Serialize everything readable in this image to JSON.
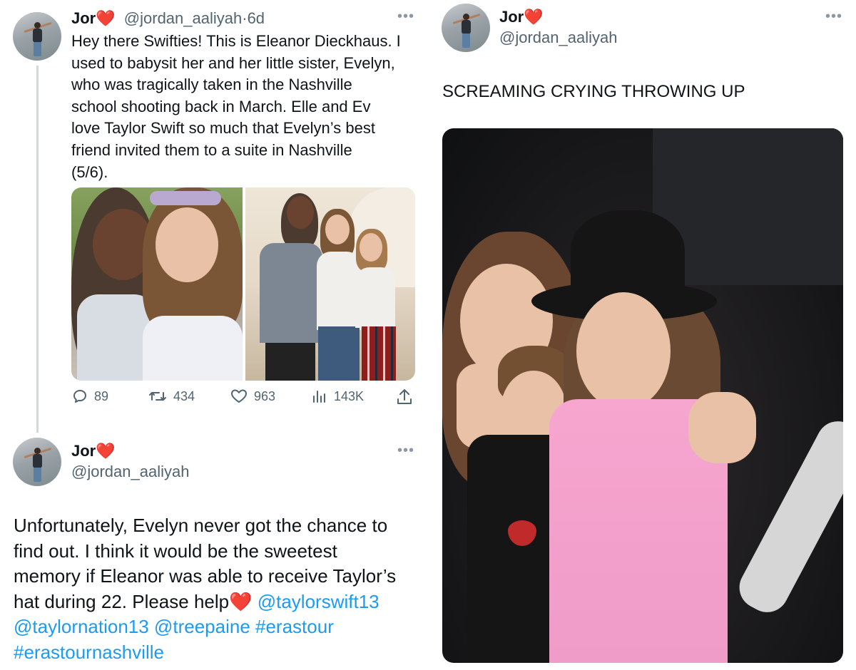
{
  "tweet1": {
    "name": "Jor",
    "heart": "❤️",
    "handle": "@jordan_aaliyah",
    "time": "6d",
    "separator": "·",
    "lines": [
      "Hey there Swifties! This is Eleanor Dieckhaus. I",
      "used to babysit her and her little sister, Evelyn,",
      "who was tragically taken in the Nashville",
      "school shooting back in March. Elle and Ev",
      "love Taylor Swift so much that Evelyn’s best",
      "friend invited them to a suite in Nashville",
      "(5/6)."
    ],
    "stats": {
      "replies": "89",
      "retweets": "434",
      "likes": "963",
      "views": "143K"
    }
  },
  "tweet2": {
    "name": "Jor",
    "heart": "❤️",
    "handle": "@jordan_aaliyah",
    "lines": [
      "Unfortunately, Evelyn never got the chance to",
      "find out. I think it would be the sweetest",
      "memory if Eleanor was able to receive Taylor’s"
    ],
    "line4_text": "hat during 22. Please help",
    "line4_heart": "❤️",
    "mention1": "@taylorswift13",
    "mention2": "@taylornation13",
    "mention3": "@treepaine",
    "hashtag1": "#erastour",
    "hashtag2": "#erastournashville"
  },
  "tweet3": {
    "name": "Jor",
    "heart": "❤️",
    "handle": "@jordan_aaliyah",
    "text": "SCREAMING CRYING THROWING UP"
  },
  "icons": {
    "more": "more-horizontal-icon",
    "reply": "reply-icon",
    "retweet": "retweet-icon",
    "like": "like-icon",
    "views": "views-icon",
    "share": "share-icon"
  },
  "colors": {
    "link": "#1d9bf0",
    "secondary": "#536471",
    "heart": "#e0245e"
  }
}
